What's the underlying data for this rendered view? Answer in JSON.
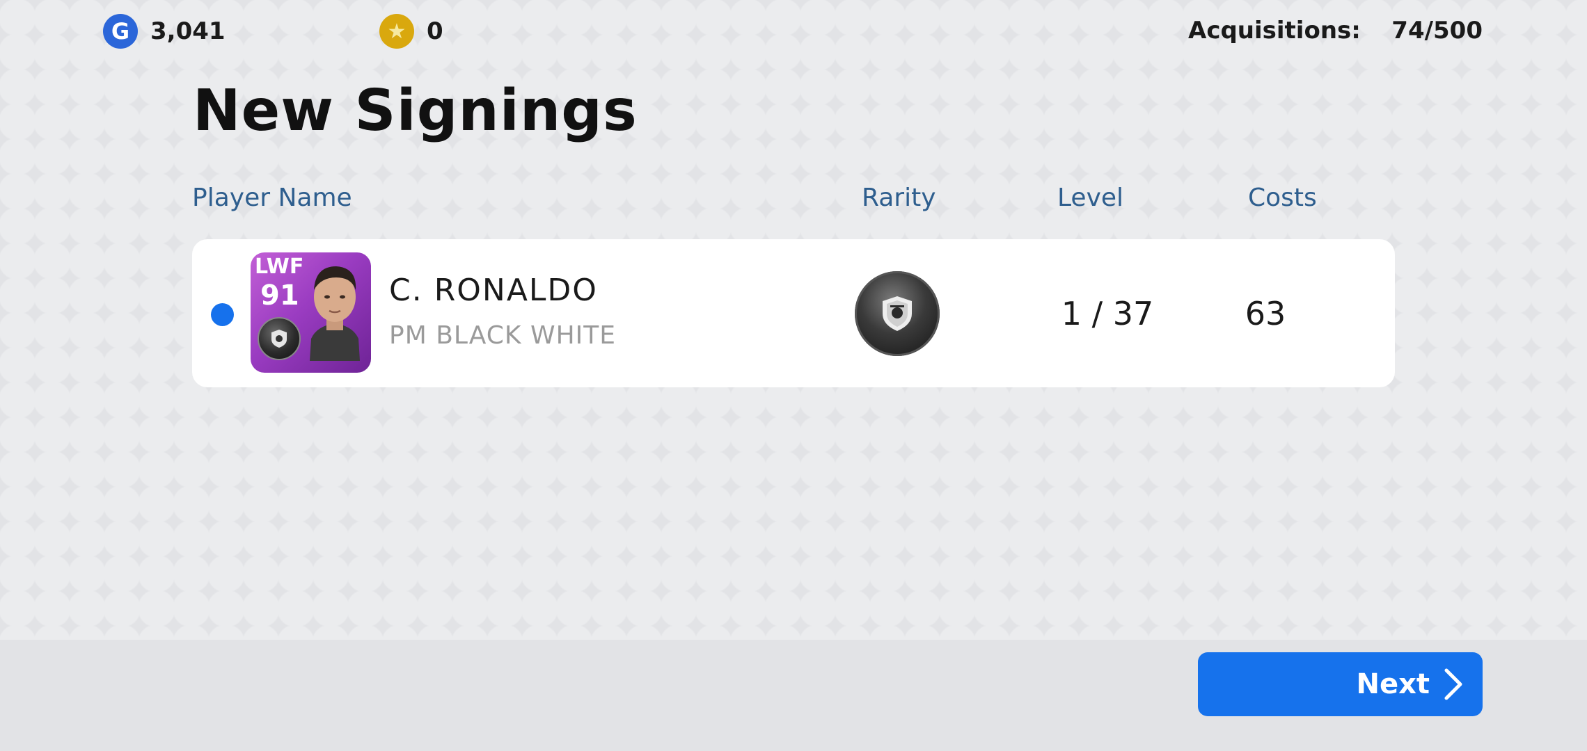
{
  "currency": {
    "gp_icon": "G",
    "gp_value": "3,041",
    "coin_icon": "★",
    "coin_value": "0"
  },
  "acquisitions": {
    "label": "Acquisitions:",
    "value": "74/500"
  },
  "title": "New Signings",
  "columns": {
    "player_name": "Player Name",
    "rarity": "Rarity",
    "level": "Level",
    "costs": "Costs"
  },
  "rows": [
    {
      "position": "LWF",
      "rating": "91",
      "name": "C. RONALDO",
      "subtitle": "PM BLACK WHITE",
      "rarity_icon": "black-ball-icon",
      "level": "1 / 37",
      "costs": "63"
    }
  ],
  "next_button": {
    "label": "Next"
  },
  "colors": {
    "accent": "#1672ec",
    "header_text": "#2e5e8e",
    "card_purple": "#9a3cc1"
  }
}
